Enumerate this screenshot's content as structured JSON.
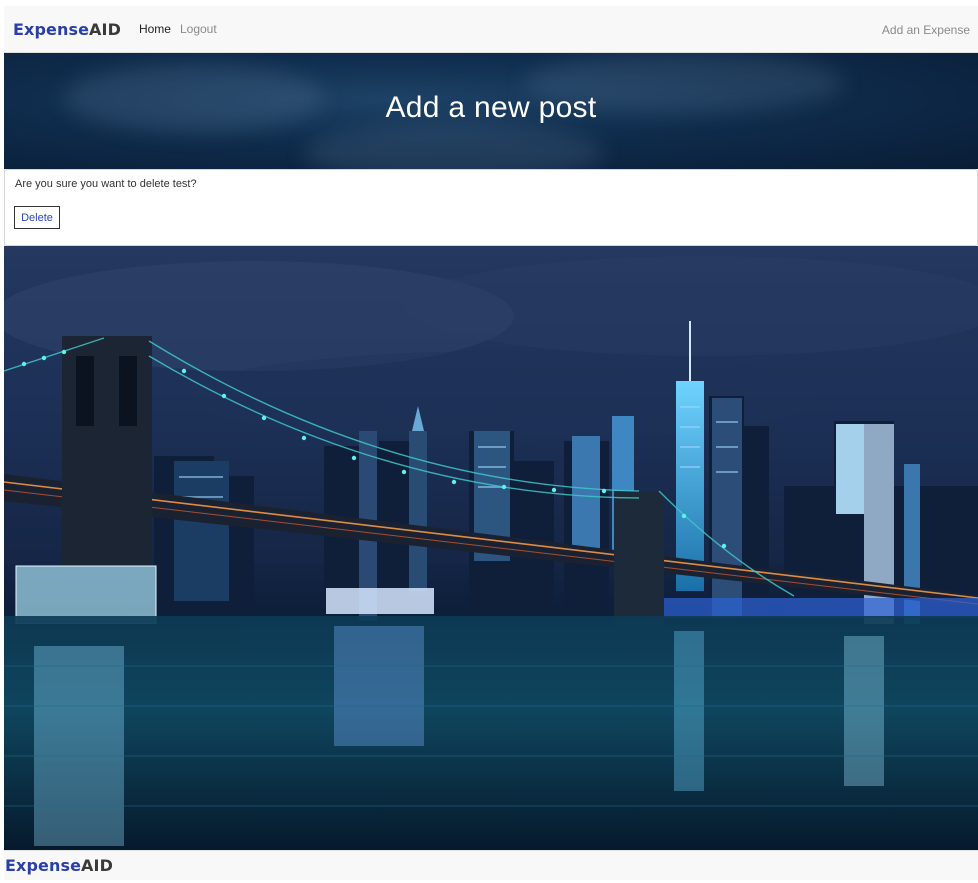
{
  "navbar": {
    "brand_part1": "Expense",
    "brand_part2": "AID",
    "home_label": "Home",
    "logout_label": "Logout",
    "add_expense_label": "Add an Expense"
  },
  "header": {
    "title": "Add a new post"
  },
  "confirm": {
    "message": "Are you sure you want to delete test?",
    "delete_label": "Delete"
  },
  "footer": {
    "brand_part1": "Expense",
    "brand_part2": "AID"
  },
  "colors": {
    "brand_blue": "#2a3fa7",
    "navbar_bg": "#f8f8f8",
    "button_text": "#2a47b8"
  }
}
